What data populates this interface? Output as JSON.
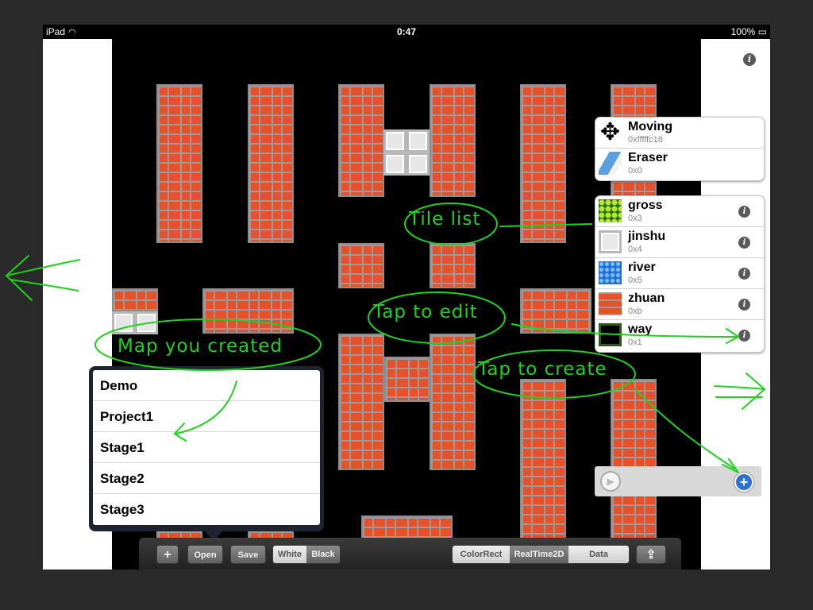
{
  "status": {
    "carrier": "iPad",
    "time": "0:47",
    "battery": "100%"
  },
  "tools": [
    {
      "name": "Moving",
      "code": "0xfffffc18"
    },
    {
      "name": "Eraser",
      "code": "0x0"
    }
  ],
  "tiles": [
    {
      "name": "gross",
      "code": "0x3"
    },
    {
      "name": "jinshu",
      "code": "0x4"
    },
    {
      "name": "river",
      "code": "0x5"
    },
    {
      "name": "zhuan",
      "code": "0xb"
    },
    {
      "name": "way",
      "code": "0x1"
    }
  ],
  "maps": [
    "Demo",
    "Project1",
    "Stage1",
    "Stage2",
    "Stage3"
  ],
  "toolbar": {
    "add": "+",
    "open": "Open",
    "save": "Save",
    "bg_white": "White",
    "bg_black": "Black",
    "mode_colorrect": "ColorRect",
    "mode_realtime2d": "RealTime2D",
    "mode_data": "Data",
    "share": "share"
  },
  "annotations": {
    "tile_list": "Tile list",
    "tap_edit": "Tap to edit",
    "tap_create": "Tap to create",
    "map_created": "Map you created"
  },
  "colors": {
    "annotation": "#1ed21e",
    "brick": "#e8502a"
  }
}
